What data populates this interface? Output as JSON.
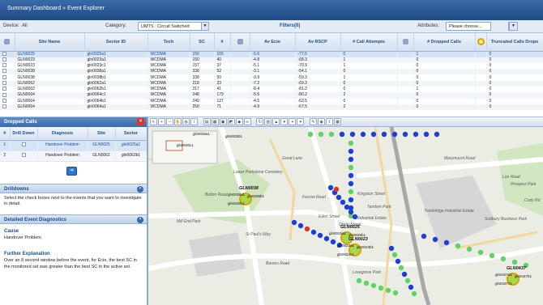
{
  "breadcrumb": {
    "part1": "Summary Dashboard",
    "sep": "»",
    "part2": "Event Explorer"
  },
  "filterbar": {
    "device_label": "Device:",
    "device_value": "All",
    "category_label": "Category:",
    "category_value": "UMTS : Circuit Switched",
    "filters_label": "Filters(0)",
    "attributes_label": "Attributes:",
    "attributes_value": "Please choose..."
  },
  "grid": {
    "headers": [
      "Site Name",
      "Sector ID",
      "Tech",
      "SC",
      "#",
      "Av Ecio",
      "Av RSCP",
      "# Call Attempts",
      "# Dropped Calls",
      "Truncated Calls Drops"
    ],
    "rows": [
      [
        "GLN0025",
        "gln0025a1",
        "WCDMA",
        "156",
        "165",
        "-5.6",
        "-77.5",
        "0",
        "1",
        "0"
      ],
      [
        "GLN0023",
        "gln0023a1",
        "WCDMA",
        "150",
        "40",
        "-4.8",
        "-68.3",
        "1",
        "0",
        "0"
      ],
      [
        "GLN0023",
        "gln0023c1",
        "WCDMA",
        "157",
        "37",
        "-5.1",
        "-70.9",
        "1",
        "0",
        "0"
      ],
      [
        "GLN0038",
        "gln0038a1",
        "WCDMA",
        "338",
        "52",
        "-3.1",
        "-54.1",
        "0",
        "0",
        "0"
      ],
      [
        "GLN0038",
        "gln0038b1",
        "WCDMA",
        "338",
        "50",
        "-3.9",
        "-59.3",
        "1",
        "0",
        "0"
      ],
      [
        "GLN0062",
        "gln0062a1",
        "WCDMA",
        "218",
        "23",
        "-7.2",
        "-69.3",
        "0",
        "0",
        "0"
      ],
      [
        "GLN0062",
        "gln0062b1",
        "WCDMA",
        "217",
        "41",
        "-8.4",
        "-81.2",
        "0",
        "1",
        "0"
      ],
      [
        "GLN0064",
        "gln0064c1",
        "WCDMA",
        "248",
        "179",
        "-5.6",
        "-80.2",
        "2",
        "0",
        "0"
      ],
      [
        "GLN0064",
        "gln0064b1",
        "WCDMA",
        "249",
        "127",
        "-4.5",
        "-63.5",
        "0",
        "0",
        "0"
      ],
      [
        "GLN0064",
        "gln0064a1",
        "WCDMA",
        "250",
        "71",
        "-4.9",
        "-67.5",
        "2",
        "0",
        "0"
      ]
    ]
  },
  "dropped": {
    "title": "Dropped Calls",
    "headers": [
      "#",
      "Drill Down",
      "Diagnosis",
      "Site",
      "Sector"
    ],
    "rows": [
      [
        "1",
        "Handover Problem",
        "GLN0025",
        "gln0025a1"
      ],
      [
        "2",
        "Handover Problem",
        "GLN0062",
        "gln0062b1"
      ]
    ],
    "arrow_glyph": "➜"
  },
  "drilldown": {
    "title": "Drilldowns",
    "text": "Select the check boxes next to the events that you want to investigate in detail."
  },
  "diagnostics": {
    "title": "Detailed Event Diagnostics",
    "cause_label": "Cause",
    "cause_value": "Handover Problem",
    "explanation_label": "Further Explanation",
    "explanation_text": "Over an 8 second window before the event, for Ecio, the best SC in the monitored set was greater than the best SC in the active set."
  },
  "map": {
    "streets": [
      "Lower Parkstone Cemetery",
      "Great Lane",
      "Bolton Road",
      "Farrow Road",
      "Mill End Park",
      "Eden Street",
      "St Paul's Way",
      "Kingston Street",
      "Marymount Road",
      "Tandem Park",
      "Dixon Street",
      "Industrial Estate",
      "Trowbridge Industrial Estate",
      "Sudbury Business Park",
      "Prospect Park",
      "Lon Road",
      "Cody Rd",
      "Barnes Road",
      "Lovegrove Park"
    ],
    "cells": [
      {
        "name": "GLN0038",
        "sectors": [
          "gln0038a1",
          "gln0038b1",
          "gln0038c1"
        ]
      },
      {
        "name": "GLN0025",
        "sectors": [
          "gln0025a1",
          "gln0025b1"
        ]
      },
      {
        "name": "GLN0023",
        "sectors": [
          "gln0023a1",
          "gln0023b1",
          "gln0023c1"
        ]
      },
      {
        "name": "GLN0437",
        "sectors": [
          "gln0437a1",
          "gln0437b1",
          "gln0437c1"
        ]
      }
    ],
    "top_labels": [
      "gln0035a1",
      "gln0035b1",
      "gln0030c1"
    ]
  },
  "colors": {
    "header_blue": "#1f4a86",
    "accent": "#3a68a5",
    "drop_red": "#d23a2c",
    "rail": "#a8a8a8",
    "sample_blue": "#1e3fd0",
    "sample_green": "#5fd36a"
  }
}
